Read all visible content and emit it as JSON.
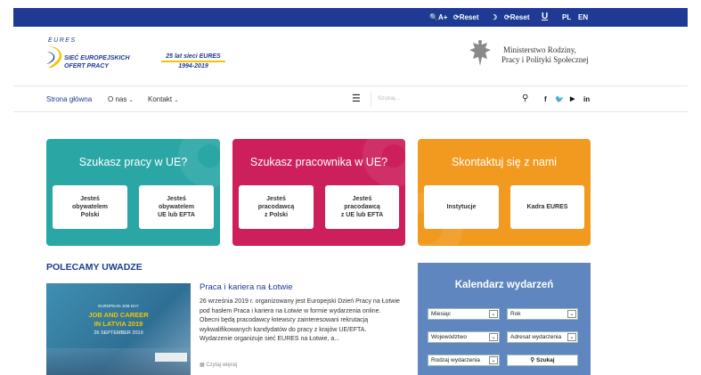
{
  "topbar": {
    "zoom_label": "A+",
    "reset1_label": "Reset",
    "reset2_label": "Reset",
    "lang_pl": "PL",
    "lang_en": "EN"
  },
  "header": {
    "logo_eures": "EURES",
    "logo_line1": "SIEĆ EUROPEJSKICH",
    "logo_line2": "OFERT PRACY",
    "anniversary_line1": "25 lat sieci EURES",
    "anniversary_line2": "1994-2019",
    "ministry_line1": "Ministerstwo Rodziny,",
    "ministry_line2": "Pracy i Polityki Społecznej"
  },
  "nav": {
    "home": "Strona główna",
    "about": "O nas",
    "contact": "Kontakt",
    "search_placeholder": "Szukaj..."
  },
  "cards": [
    {
      "title": "Szukasz pracy w UE?",
      "color": "#2aa7a5",
      "boxes": [
        "Jesteś\nobywatelem\nPolski",
        "Jesteś\nobywatelem\nUE lub EFTA"
      ]
    },
    {
      "title": "Szukasz pracownika w UE?",
      "color": "#cc1f5c",
      "boxes": [
        "Jesteś\npracodawcą\nz Polski",
        "Jesteś\npracodawcą\nz UE lub EFTA"
      ]
    },
    {
      "title": "Skontaktuj się z nami",
      "color": "#f29a20",
      "boxes": [
        "Instytucje",
        "Kadra EURES"
      ]
    }
  ],
  "featured": {
    "section_title": "POLECAMY UWADZE",
    "article_title": "Praca i kariera na Łotwie",
    "article_body": "26 września 2019 r. organizowany jest Europejski Dzień Pracy na Łotwie pod hasłem Praca i kariera na Łotwie w formie wydarzenia online. Obecni będą pracodawcy łotewscy zainteresowani rekrutacją wykwalifikowanych kandydatów do pracy z krajów UE/EFTA. Wydarzenie organizuje sieć EURES na Łotwie, a...",
    "read_more": "Czytaj więcej",
    "image_small": "EUROPEAN JOB DAY",
    "image_line1": "JOB AND CAREER",
    "image_line2": "IN LATVIA 2019",
    "image_date": "26 SEPTEMBER 2019"
  },
  "calendar": {
    "title": "Kalendarz wydarzeń",
    "month": "Miesiąc",
    "year": "Rok",
    "voivodeship": "Województwo",
    "audience": "Adresat wydarzenia",
    "event_type": "Rodzaj wydarzenia",
    "search_button": "Szukaj"
  }
}
